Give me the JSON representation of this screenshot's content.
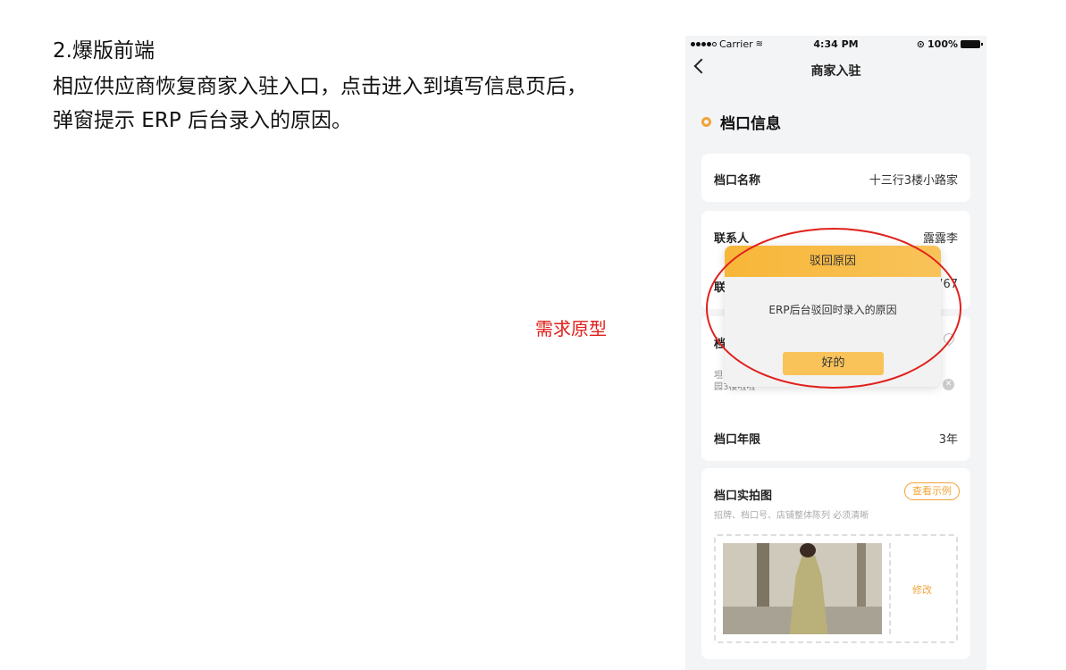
{
  "doc": {
    "heading": "2.爆版前端",
    "line1": "相应供应商恢复商家入驻入口，点击进入到填写信息页后，",
    "line2": "弹窗提示 ERP 后台录入的原因。",
    "req_label": "需求原型"
  },
  "phone": {
    "status": {
      "carrier": "Carrier",
      "time": "4:34 PM",
      "battery": "100%"
    },
    "nav": {
      "title": "商家入驻"
    },
    "section_title": "档口信息",
    "stall_name": {
      "label": "档口名称",
      "value": "十三行3楼小路家"
    },
    "contact": {
      "label": "联系人",
      "value": "露露李"
    },
    "contact_phone": {
      "label_partial": "联",
      "value_partial": "767"
    },
    "address": {
      "label_partial": "档",
      "text_line1": "坦",
      "text_line2": "园3楼啦啦"
    },
    "years": {
      "label": "档口年限",
      "value": "3年"
    },
    "photos": {
      "title": "档口实拍图",
      "hint": "招牌、档口号、店铺整体陈列 必须清晰",
      "example_label": "查看示例",
      "modify_label": "修改"
    },
    "dialog": {
      "title": "驳回原因",
      "message": "ERP后台驳回时录入的原因",
      "button": "好的"
    }
  },
  "colors": {
    "accent": "#f2a43a",
    "dialog_header": "#f7b638",
    "annotation": "#e0201b",
    "background": "#f3f4f6"
  }
}
